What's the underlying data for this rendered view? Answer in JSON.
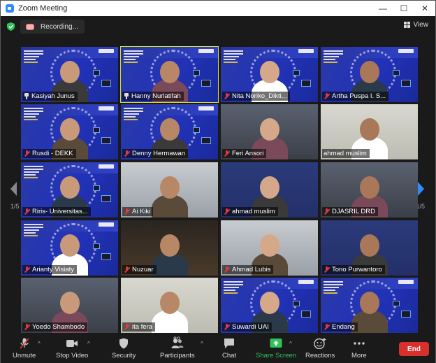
{
  "window": {
    "title": "Zoom Meeting",
    "minimize": "—",
    "maximize": "☐",
    "close": "✕"
  },
  "topbar": {
    "recording_label": "Recording...",
    "view_label": "View"
  },
  "gallery": {
    "page_left": "1/5",
    "page_right": "1/5",
    "tiles": [
      {
        "name": "Kasiyah Junus",
        "type": "slide",
        "status": "pinned"
      },
      {
        "name": "Hanny Nurlatifah",
        "type": "slide",
        "status": "pinned",
        "active": true
      },
      {
        "name": "Nita Noriko_Dikti...",
        "type": "slide",
        "status": "muted"
      },
      {
        "name": "Artha Puspa I. S...",
        "type": "slide",
        "status": "muted"
      },
      {
        "name": "Rusdi - DEKK",
        "type": "slide",
        "status": "muted"
      },
      {
        "name": "Denny Hermawan",
        "type": "slide",
        "status": "muted"
      },
      {
        "name": "Feri Ansori",
        "type": "camera",
        "status": "muted"
      },
      {
        "name": "ahmad muslim",
        "type": "camera",
        "status": "none"
      },
      {
        "name": "Riris- Universitas...",
        "type": "slide",
        "status": "muted"
      },
      {
        "name": "Ai Kiki",
        "type": "camera",
        "status": "muted"
      },
      {
        "name": "ahmad muslim",
        "type": "camera",
        "status": "muted"
      },
      {
        "name": "DJASRIL DRD",
        "type": "camera",
        "status": "muted"
      },
      {
        "name": "Arianty Visiaty",
        "type": "slide",
        "status": "muted"
      },
      {
        "name": "Nuzuar",
        "type": "camera",
        "status": "muted"
      },
      {
        "name": "Ahmad Lubis",
        "type": "camera",
        "status": "muted"
      },
      {
        "name": "Tono Purwantoro",
        "type": "camera",
        "status": "muted"
      },
      {
        "name": "Yoedo Shambodo",
        "type": "camera",
        "status": "muted"
      },
      {
        "name": "ita fera",
        "type": "camera",
        "status": "muted"
      },
      {
        "name": "Suwardi UAI",
        "type": "slide",
        "status": "muted"
      },
      {
        "name": "Endang",
        "type": "slide",
        "status": "muted"
      }
    ]
  },
  "toolbar": {
    "unmute": "Unmute",
    "stop_video": "Stop Video",
    "security": "Security",
    "participants": "Participants",
    "participants_count": "89",
    "chat": "Chat",
    "share_screen": "Share Screen",
    "reactions": "Reactions",
    "more": "More",
    "end": "End"
  },
  "colors": {
    "accent_green": "#2ec45a",
    "end_red": "#d9302c",
    "active_border": "#d6e23a",
    "nav_blue": "#2d8cff"
  }
}
